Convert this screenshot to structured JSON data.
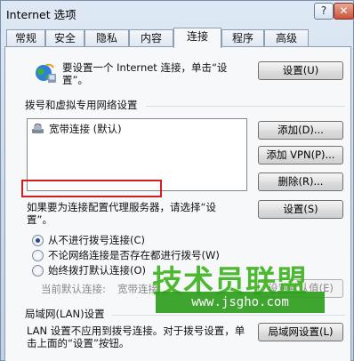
{
  "window": {
    "title": "Internet 选项",
    "help_glyph": "?",
    "close_glyph": "✕"
  },
  "tabs": [
    "常规",
    "安全",
    "隐私",
    "内容",
    "连接",
    "程序",
    "高级"
  ],
  "setup": {
    "icon": "globe-network-icon",
    "text_line1": "要设置一个 Internet 连接，单击“设",
    "text_line2": "置”。",
    "button": "设置(U)"
  },
  "dialup": {
    "group_label": "拨号和虚拟专用网络设置",
    "connections": [
      {
        "icon": "dialup-connection-icon",
        "label": "宽带连接 (默认)"
      }
    ],
    "add_button": "添加(D)...",
    "add_vpn_button": "添加 VPN(P)...",
    "remove_button": "删除(R)...",
    "proxy_text_line1": "如果要为连接配置代理服务器，请选择“设",
    "proxy_text_line2": "置”。",
    "settings_button": "设置(S)",
    "options": [
      {
        "label": "从不进行拨号连接(C)",
        "checked": true
      },
      {
        "label": "不论网络连接是否存在都进行拨号(W)",
        "checked": false
      },
      {
        "label": "始终拨打默认连接(O)",
        "checked": false
      }
    ],
    "current_default_label": "当前默认连接:",
    "current_default_value": "宽带连接",
    "set_default_button": "设置默认值(E)"
  },
  "lan": {
    "group_label": "局域网(LAN)设置",
    "text_line1": "LAN 设置不应用到拨号连接。对于拨号设置，单",
    "text_line2": "击上面的“设置”按钮。",
    "button": "局域网设置(L)"
  },
  "watermark": {
    "text": "技术员联盟",
    "url": "www.jsgho.com"
  },
  "colors": {
    "highlight_border": "#d01f1f",
    "watermark_green": "#3fb41f"
  }
}
